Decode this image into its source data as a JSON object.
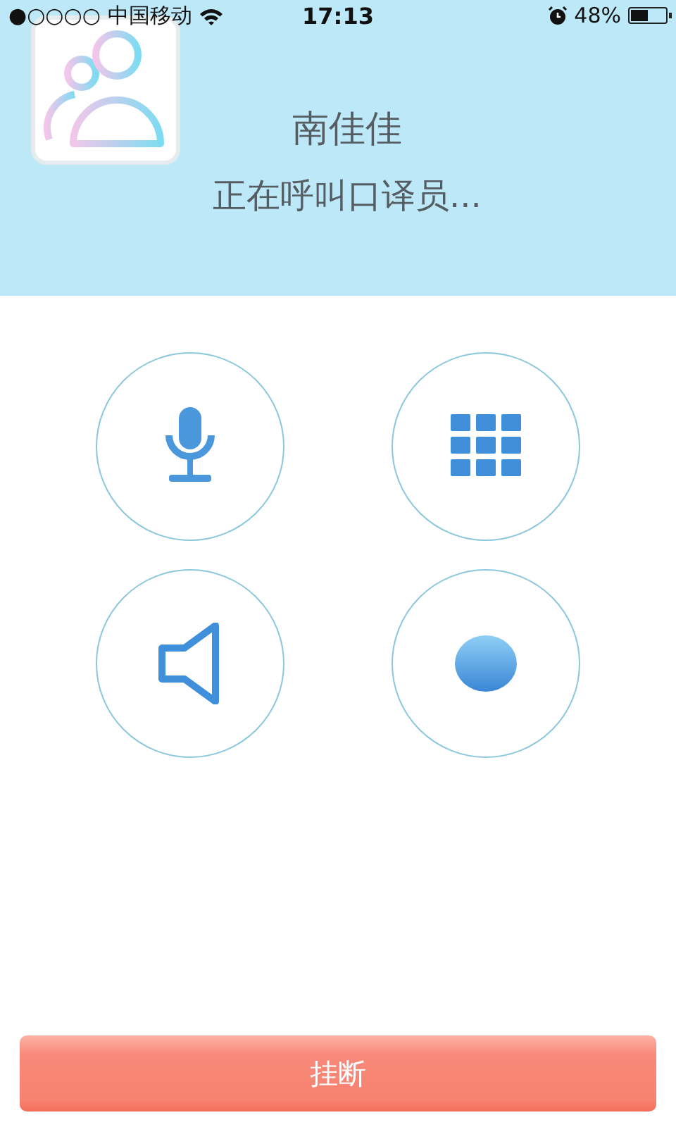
{
  "status_bar": {
    "signal": "●○○○○",
    "carrier": "中国移动",
    "time": "17:13",
    "battery": "48%"
  },
  "caller": {
    "name": "南佳佳",
    "status": "正在呼叫口译员..."
  },
  "controls": [
    {
      "kind": "mic"
    },
    {
      "kind": "keypad"
    },
    {
      "kind": "speaker"
    },
    {
      "kind": "record"
    }
  ],
  "hangup": {
    "label": "挂断"
  }
}
